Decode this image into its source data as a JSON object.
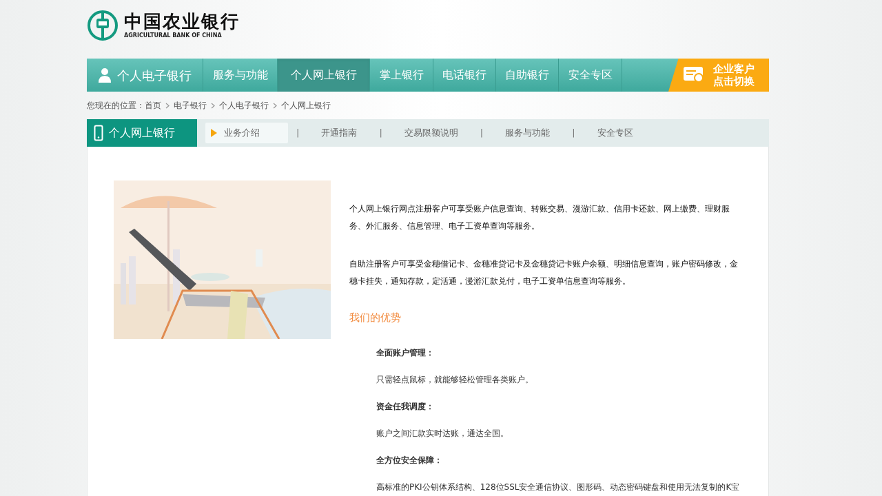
{
  "logo": {
    "title": "中国农业银行",
    "subtitle": "AGRICULTURAL BANK OF CHINA"
  },
  "main_nav": {
    "items": [
      {
        "label": "个人电子银行",
        "kind": "home",
        "selected": false
      },
      {
        "label": "服务与功能",
        "kind": "link",
        "selected": false
      },
      {
        "label": "个人网上银行",
        "kind": "link",
        "selected": true
      },
      {
        "label": "掌上银行",
        "kind": "link",
        "selected": false
      },
      {
        "label": "电话银行",
        "kind": "link",
        "selected": false
      },
      {
        "label": "自助银行",
        "kind": "link",
        "selected": false
      },
      {
        "label": "安全专区",
        "kind": "link",
        "selected": false
      }
    ],
    "corporate_switch": {
      "lines": [
        "企业客户",
        "点击切换"
      ]
    }
  },
  "breadcrumb": {
    "prefix": "您现在的位置：",
    "items": [
      "首页",
      "电子银行",
      "个人电子银行",
      "个人网上银行"
    ]
  },
  "section": {
    "title": "个人网上银行",
    "separator": "|",
    "tabs": [
      {
        "label": "业务介绍",
        "selected": true
      },
      {
        "label": "开通指南",
        "selected": false
      },
      {
        "label": "交易限额说明",
        "selected": false
      },
      {
        "label": "服务与功能",
        "selected": false
      },
      {
        "label": "安全专区",
        "selected": false
      }
    ]
  },
  "content": {
    "paragraphs": [
      "个人网上银行网点注册客户可享受账户信息查询、转账交易、漫游汇款、信用卡还款、网上缴费、理财服务、外汇服务、信息管理、电子工资单查询等服务。",
      "自助注册客户可享受金穗借记卡、金穗准贷记卡及金穗贷记卡账户余额、明细信息查询，账户密码修改，金穗卡挂失，通知存款，定活通，漫游汇款兑付，电子工资单信息查询等服务。"
    ],
    "advantages_title": "我们的优势",
    "advantages": [
      {
        "title": "全面账户管理：",
        "body": "只需轻点鼠标，就能够轻松管理各类账户。"
      },
      {
        "title": "资金任我调度：",
        "body": "账户之间汇款实时达账，通达全国。"
      },
      {
        "title": "全方位安全保障：",
        "body": "高标准的PKI公钥体系结构、128位SSL安全通信协议、图形码、动态密码键盘和使用无法复制的K宝"
      }
    ]
  }
}
